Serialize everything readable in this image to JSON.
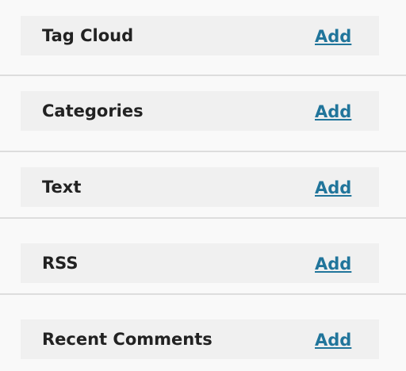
{
  "widgets": [
    {
      "title": "Tag Cloud",
      "action": "Add"
    },
    {
      "title": "Categories",
      "action": "Add"
    },
    {
      "title": "Text",
      "action": "Add"
    },
    {
      "title": "RSS",
      "action": "Add"
    },
    {
      "title": "Recent Comments",
      "action": "Add"
    }
  ],
  "colors": {
    "background": "#f9f9f9",
    "row_background": "#f0f0f0",
    "separator": "#dddddd",
    "title_text": "#222222",
    "link": "#21759b"
  }
}
